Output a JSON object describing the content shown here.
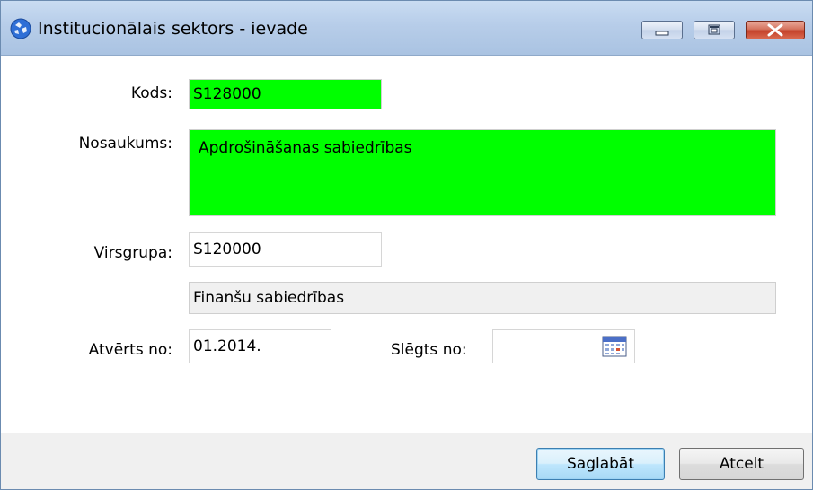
{
  "window": {
    "title": "Institucionālais sektors - ievade"
  },
  "form": {
    "kods": {
      "label": "Kods:",
      "value": "S128000"
    },
    "nosaukums": {
      "label": "Nosaukums:",
      "value": "Apdrošināšanas sabiedrības"
    },
    "virsgrupa": {
      "label": "Virsgrupa:",
      "value": "S120000",
      "description": "Finanšu sabiedrības"
    },
    "atverts_no": {
      "label": "Atvērts no:",
      "value": "01.2014."
    },
    "slegts_no": {
      "label": "Slēgts no:",
      "value": ""
    }
  },
  "buttons": {
    "save": "Saglabāt",
    "cancel": "Atcelt"
  },
  "colors": {
    "required_field": "#00ff00",
    "titlebar": "#b7cde9",
    "close_button": "#c4412a"
  },
  "icons": {
    "app": "app-globe-icon",
    "minimize": "minimize-icon",
    "maximize": "maximize-icon",
    "close": "close-icon",
    "calendar": "calendar-icon"
  }
}
